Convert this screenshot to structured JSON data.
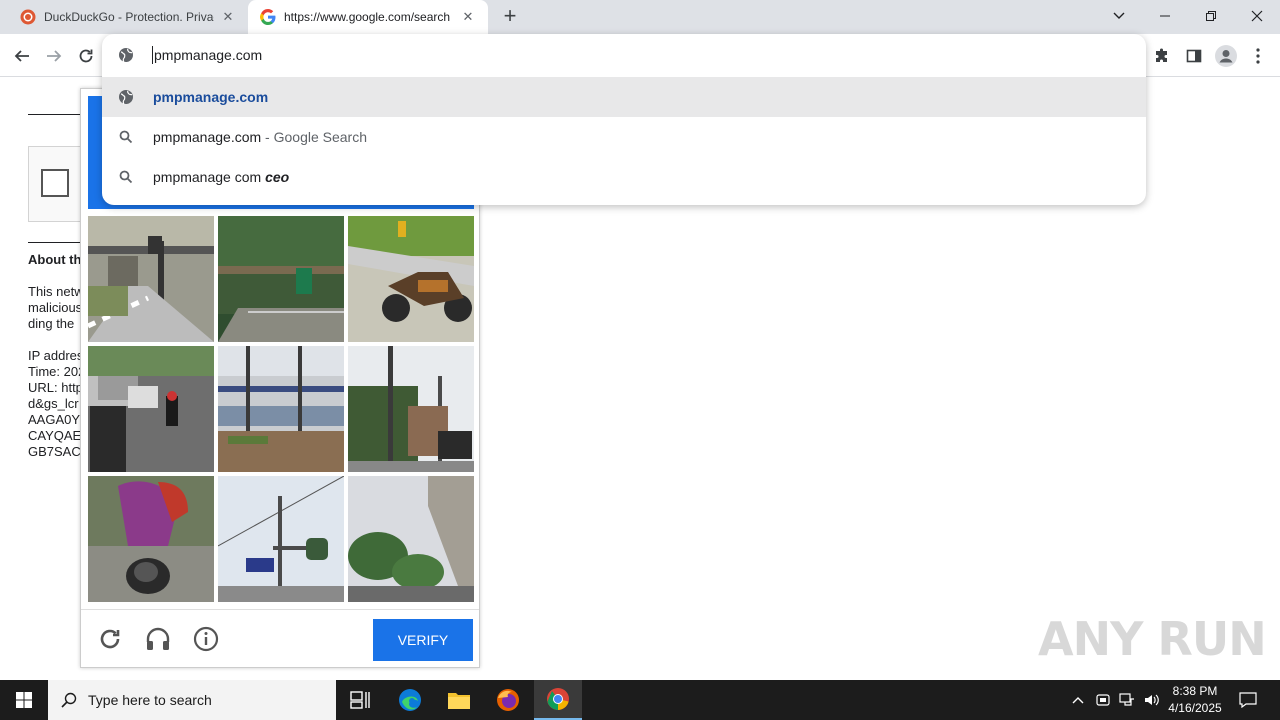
{
  "browser": {
    "tabs": [
      {
        "title": "DuckDuckGo - Protection. Privac",
        "favicon": "duckduckgo-icon",
        "active": false
      },
      {
        "title": "https://www.google.com/search",
        "favicon": "google-icon",
        "active": true
      }
    ],
    "new_tab": "+",
    "omnibox": {
      "value": "pmpmanage.com",
      "suggestions": [
        {
          "icon": "globe-icon",
          "text": "pmpmanage.com",
          "selected": true
        },
        {
          "icon": "search-icon",
          "text": "pmpmanage.com",
          "suffix": " - Google Search"
        },
        {
          "icon": "search-icon",
          "text": "pmpmanage com ",
          "bold_suffix": "ceo"
        }
      ]
    }
  },
  "page": {
    "about_heading": "About th",
    "paragraph": [
      "This netw",
      "malicious",
      "ding the"
    ],
    "details": [
      "IP addres",
      "Time: 202",
      "URL: http",
      "d&gs_lcr",
      "AAGA0Y",
      "CAYQAE",
      "GB7SAC"
    ]
  },
  "captcha": {
    "verify_label": "VERIFY",
    "footer_icons": [
      "reload-icon",
      "headphones-icon",
      "info-icon"
    ],
    "header_color": "#1a73e8"
  },
  "watermark": "ANY RUN",
  "taskbar": {
    "search_placeholder": "Type here to search",
    "time": "8:38 PM",
    "date": "4/16/2025"
  }
}
